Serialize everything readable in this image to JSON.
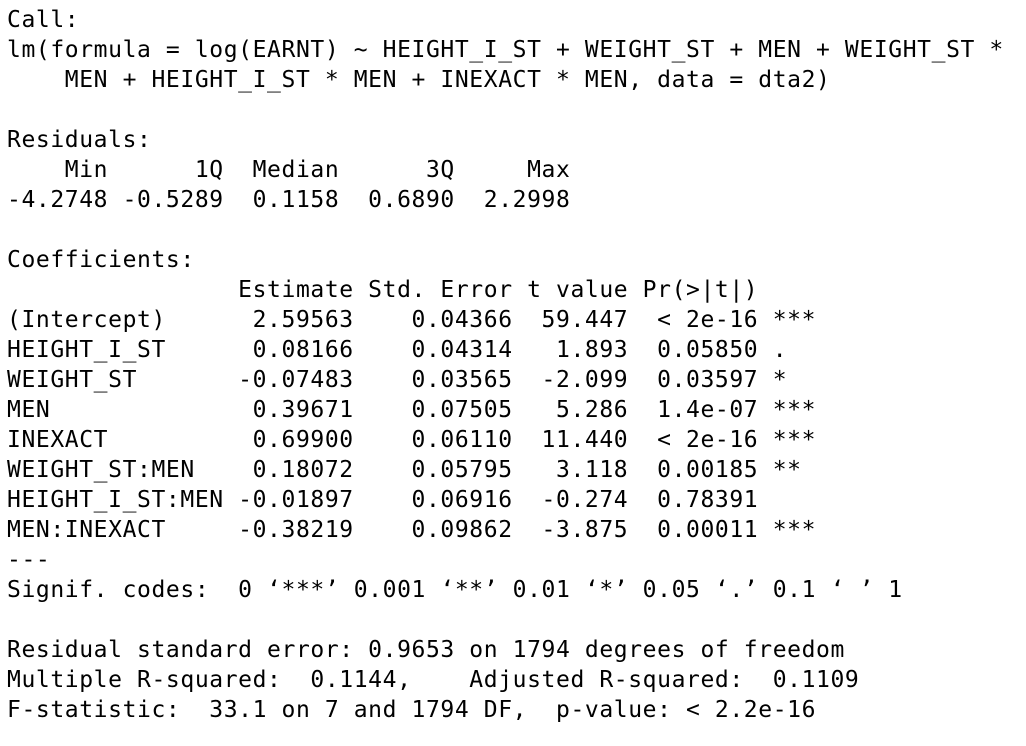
{
  "output": {
    "call_header": "Call:",
    "call_line_1": "lm(formula = log(EARNT) ~ HEIGHT_I_ST + WEIGHT_ST + MEN + WEIGHT_ST *",
    "call_line_2": "    MEN + HEIGHT_I_ST * MEN + INEXACT * MEN, data = dta2)",
    "residuals_header": "Residuals:",
    "residuals_labels": "    Min      1Q  Median      3Q     Max ",
    "residuals_values": "-4.2748 -0.5289  0.1158  0.6890  2.2998 ",
    "coefficients_header": "Coefficients:",
    "coef_columns": "                Estimate Std. Error t value Pr(>|t|)    ",
    "coef_rows": [
      "(Intercept)      2.59563    0.04366  59.447  < 2e-16 ***",
      "HEIGHT_I_ST      0.08166    0.04314   1.893  0.05850 .  ",
      "WEIGHT_ST       -0.07483    0.03565  -2.099  0.03597 *  ",
      "MEN              0.39671    0.07505   5.286  1.4e-07 ***",
      "INEXACT          0.69900    0.06110  11.440  < 2e-16 ***",
      "WEIGHT_ST:MEN    0.18072    0.05795   3.118  0.00185 ** ",
      "HEIGHT_I_ST:MEN -0.01897    0.06916  -0.274  0.78391    ",
      "MEN:INEXACT     -0.38219    0.09862  -3.875  0.00011 ***"
    ],
    "separator": "---",
    "signif_codes": "Signif. codes:  0 ‘***’ 0.001 ‘**’ 0.01 ‘*’ 0.05 ‘.’ 0.1 ‘ ’ 1",
    "residual_se": "Residual standard error: 0.9653 on 1794 degrees of freedom",
    "r_squared": "Multiple R-squared:  0.1144,\tAdjusted R-squared:  0.1109 ",
    "f_statistic": "F-statistic:  33.1 on 7 and 1794 DF,  p-value: < 2.2e-16"
  }
}
